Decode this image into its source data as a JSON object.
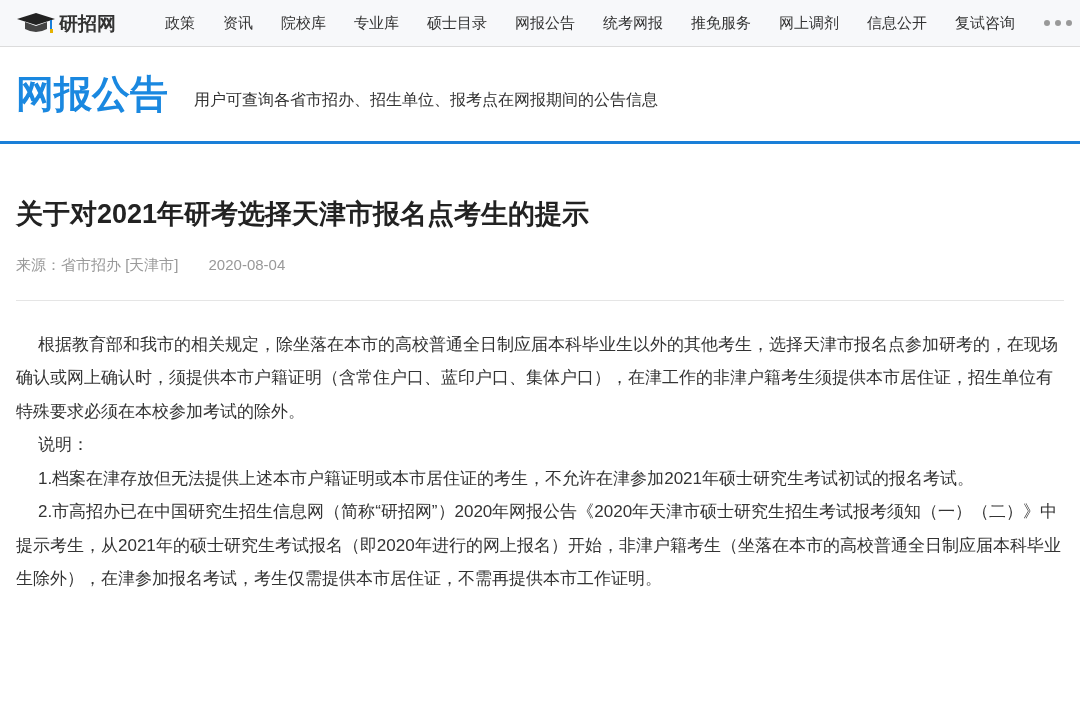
{
  "brand": {
    "name": "研招网"
  },
  "nav": {
    "items": [
      "政策",
      "资讯",
      "院校库",
      "专业库",
      "硕士目录",
      "网报公告",
      "统考网报",
      "推免服务",
      "网上调剂",
      "信息公开",
      "复试咨询"
    ]
  },
  "section": {
    "title": "网报公告",
    "subtitle": "用户可查询各省市招办、招生单位、报考点在网报期间的公告信息"
  },
  "article": {
    "title": "关于对2021年研考选择天津市报名点考生的提示",
    "source": "来源：省市招办 [天津市]",
    "date": "2020-08-04",
    "paragraphs": [
      "根据教育部和我市的相关规定，除坐落在本市的高校普通全日制应届本科毕业生以外的其他考生，选择天津市报名点参加研考的，在现场确认或网上确认时，须提供本市户籍证明（含常住户口、蓝印户口、集体户口），在津工作的非津户籍考生须提供本市居住证，招生单位有特殊要求必须在本校参加考试的除外。",
      "说明：",
      "1.档案在津存放但无法提供上述本市户籍证明或本市居住证的考生，不允许在津参加2021年硕士研究生考试初试的报名考试。",
      "2.市高招办已在中国研究生招生信息网（简称“研招网”）2020年网报公告《2020年天津市硕士研究生招生考试报考须知（一）（二）》中提示考生，从2021年的硕士研究生考试报名（即2020年进行的网上报名）开始，非津户籍考生（坐落在本市的高校普通全日制应届本科毕业生除外），在津参加报名考试，考生仅需提供本市居住证，不需再提供本市工作证明。"
    ]
  }
}
